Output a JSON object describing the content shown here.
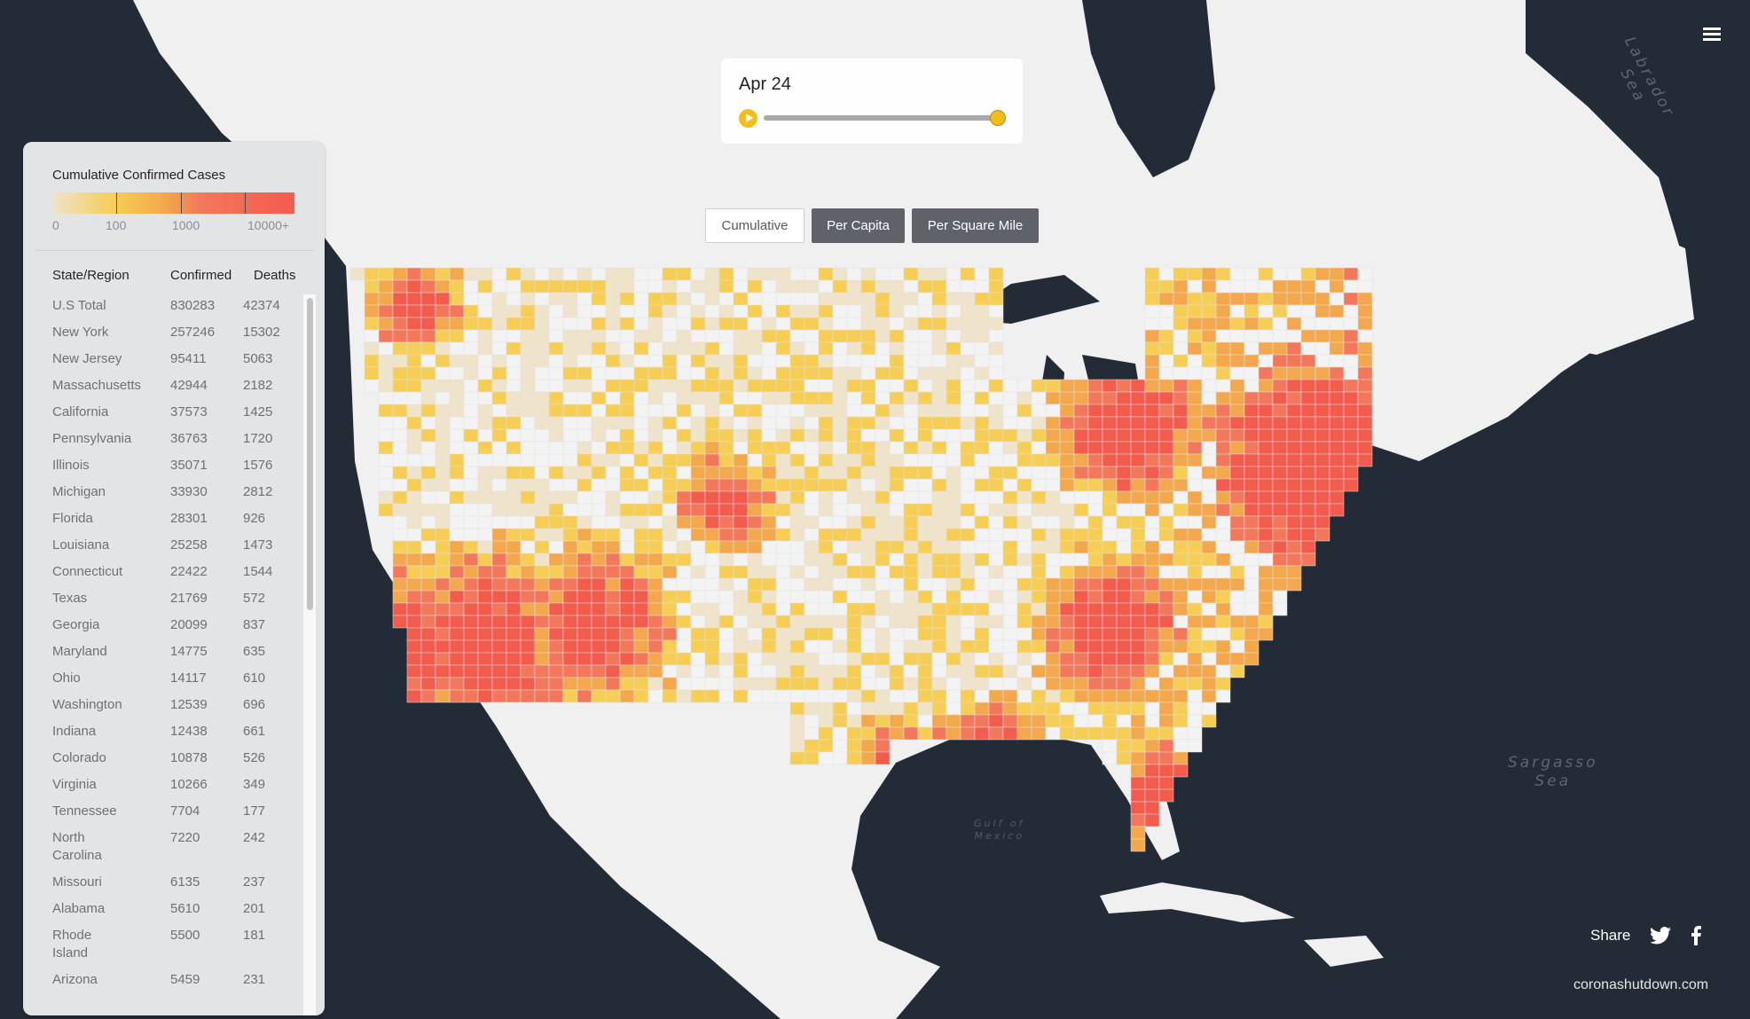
{
  "date_panel": {
    "current_date": "Apr 24",
    "play_icon": "play-icon",
    "timeline_progress": 1.0
  },
  "modes": {
    "cumulative": "Cumulative",
    "per_capita": "Per Capita",
    "per_square_mile": "Per Square Mile",
    "selected": "Cumulative"
  },
  "legend": {
    "title": "Cumulative Confirmed Cases",
    "labels": [
      "0",
      "100",
      "1000",
      "10000+"
    ],
    "colors": [
      "#efe3c9",
      "#f6cd55",
      "#f4a84d",
      "#f3775a",
      "#f35b4d"
    ]
  },
  "table": {
    "headers": {
      "region": "State/Region",
      "confirmed": "Confirmed",
      "deaths": "Deaths"
    },
    "rows": [
      {
        "region": "U.S Total",
        "confirmed": "830283",
        "deaths": "42374"
      },
      {
        "region": "New York",
        "confirmed": "257246",
        "deaths": "15302"
      },
      {
        "region": "New Jersey",
        "confirmed": "95411",
        "deaths": "5063"
      },
      {
        "region": "Massachusetts",
        "confirmed": "42944",
        "deaths": "2182"
      },
      {
        "region": "California",
        "confirmed": "37573",
        "deaths": "1425"
      },
      {
        "region": "Pennsylvania",
        "confirmed": "36763",
        "deaths": "1720"
      },
      {
        "region": "Illinois",
        "confirmed": "35071",
        "deaths": "1576"
      },
      {
        "region": "Michigan",
        "confirmed": "33930",
        "deaths": "2812"
      },
      {
        "region": "Florida",
        "confirmed": "28301",
        "deaths": "926"
      },
      {
        "region": "Louisiana",
        "confirmed": "25258",
        "deaths": "1473"
      },
      {
        "region": "Connecticut",
        "confirmed": "22422",
        "deaths": "1544"
      },
      {
        "region": "Texas",
        "confirmed": "21769",
        "deaths": "572"
      },
      {
        "region": "Georgia",
        "confirmed": "20099",
        "deaths": "837"
      },
      {
        "region": "Maryland",
        "confirmed": "14775",
        "deaths": "635"
      },
      {
        "region": "Ohio",
        "confirmed": "14117",
        "deaths": "610"
      },
      {
        "region": "Washington",
        "confirmed": "12539",
        "deaths": "696"
      },
      {
        "region": "Indiana",
        "confirmed": "12438",
        "deaths": "661"
      },
      {
        "region": "Colorado",
        "confirmed": "10878",
        "deaths": "526"
      },
      {
        "region": "Virginia",
        "confirmed": "10266",
        "deaths": "349"
      },
      {
        "region": "Tennessee",
        "confirmed": "7704",
        "deaths": "177"
      },
      {
        "region": "North Carolina",
        "confirmed": "7220",
        "deaths": "242"
      },
      {
        "region": "Missouri",
        "confirmed": "6135",
        "deaths": "237"
      },
      {
        "region": "Alabama",
        "confirmed": "5610",
        "deaths": "201"
      },
      {
        "region": "Rhode Island",
        "confirmed": "5500",
        "deaths": "181"
      },
      {
        "region": "Arizona",
        "confirmed": "5459",
        "deaths": "231"
      }
    ]
  },
  "map_labels": {
    "sargasso": "Sargasso\nSea",
    "gulf": "Gulf of\nMexico",
    "labrador": "Labrador Sea"
  },
  "map_colors": {
    "water": "#232b36",
    "land": "#f1f1f1",
    "no_data": "#f3f3f3"
  },
  "footer": {
    "share_label": "Share",
    "site": "coronashutdown.com"
  },
  "icons": {
    "menu": "menu-icon",
    "twitter": "twitter-icon",
    "facebook": "facebook-icon"
  }
}
